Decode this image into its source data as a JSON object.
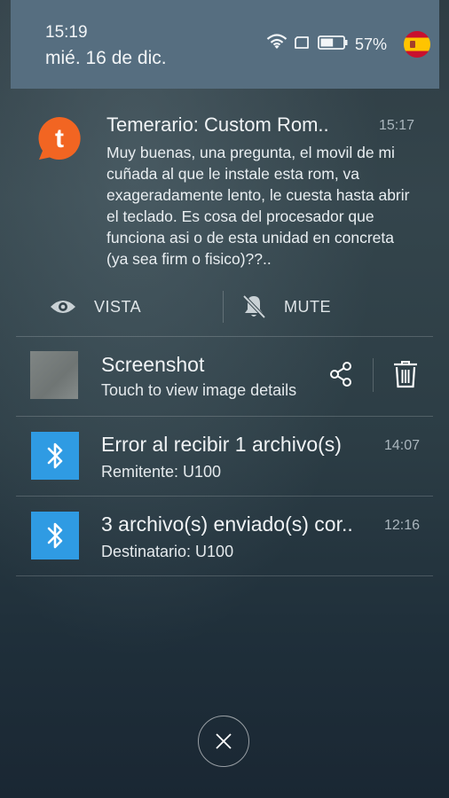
{
  "status": {
    "time": "15:19",
    "date": "mié. 16 de dic.",
    "battery_percent": "57%",
    "battery_level": 0.57,
    "icons": [
      "wifi-icon",
      "sim-icon",
      "battery-icon",
      "spain-flag-icon"
    ]
  },
  "notifications": {
    "app": {
      "icon": "tapatalk-icon",
      "icon_letter": "t",
      "title": "Temerario: Custom Rom..",
      "time": "15:17",
      "body": "Muy buenas, una pregunta, el movil de mi cuñada al que le instale esta rom, va exageradamente lento, le cuesta hasta abrir el teclado. Es cosa del procesador que funciona asi o de esta unidad en concreta (ya sea firm o fisico)??..",
      "actions": [
        {
          "label": "VISTA",
          "icon": "eye-icon"
        },
        {
          "label": "MUTE",
          "icon": "bell-off-icon"
        }
      ]
    },
    "screenshot": {
      "title": "Screenshot",
      "subtitle": "Touch to view image details",
      "icons": [
        "share-icon",
        "trash-icon"
      ]
    },
    "bt_error": {
      "title": "Error al recibir 1 archivo(s)",
      "subtitle": "Remitente: U100",
      "time": "14:07",
      "icon": "bluetooth-icon"
    },
    "bt_sent": {
      "title": "3 archivo(s) enviado(s) cor..",
      "subtitle": "Destinatario: U100",
      "time": "12:16",
      "icon": "bluetooth-icon"
    }
  },
  "close_button": {
    "icon": "close-icon"
  },
  "colors": {
    "header": "#566e80",
    "accent_orange": "#f26522",
    "bluetooth_blue": "#2f9be3"
  }
}
